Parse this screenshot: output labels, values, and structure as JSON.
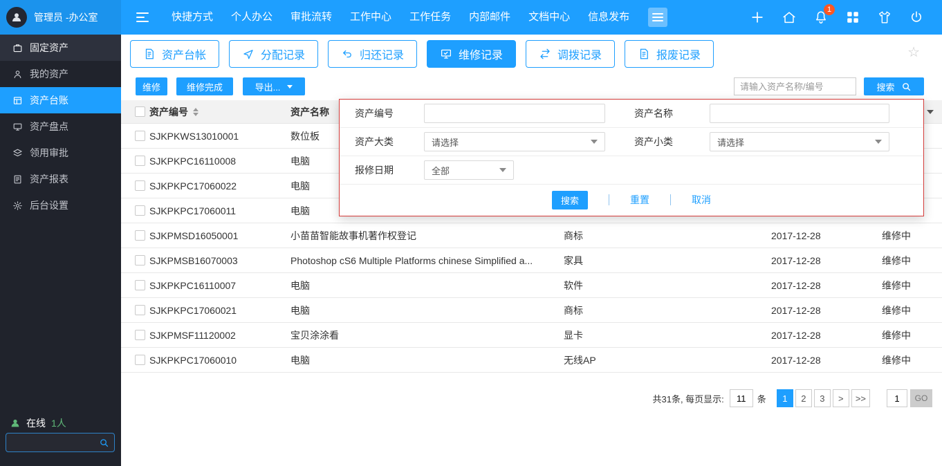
{
  "colors": {
    "accent": "#1e9fff",
    "sidebar_bg": "#20232c",
    "panel_border": "#d43c3a",
    "badge_red": "#ff5722",
    "online_green": "#5fb878"
  },
  "topbar": {
    "user_name": "管理员 -办公室",
    "nav_items": [
      "快捷方式",
      "个人办公",
      "审批流转",
      "工作中心",
      "工作任务",
      "内部邮件",
      "文档中心",
      "信息发布"
    ],
    "notification_count": "1"
  },
  "sidebar": {
    "items": [
      {
        "label": "固定资产"
      },
      {
        "label": "我的资产"
      },
      {
        "label": "资产台账"
      },
      {
        "label": "资产盘点"
      },
      {
        "label": "领用审批"
      },
      {
        "label": "资产报表"
      },
      {
        "label": "后台设置"
      }
    ],
    "online_label": "在线",
    "online_count": "1人"
  },
  "tabs": {
    "items": [
      {
        "label": "资产台帐"
      },
      {
        "label": "分配记录"
      },
      {
        "label": "归还记录"
      },
      {
        "label": "维修记录"
      },
      {
        "label": "调拨记录"
      },
      {
        "label": "报废记录"
      }
    ],
    "active_index": 3
  },
  "toolbar": {
    "repair_btn": "维修",
    "repair_done_btn": "维修完成",
    "export_btn": "导出...",
    "search_placeholder": "请输入资产名称/编号",
    "search_btn": "搜索"
  },
  "table": {
    "headers": {
      "code": "资产编号",
      "name": "资产名称"
    },
    "rows": [
      {
        "code": "SJKPKWS13010001",
        "name": "数位板",
        "category": "",
        "date": "",
        "status": ""
      },
      {
        "code": "SJKPKPC16110008",
        "name": "电脑",
        "category": "",
        "date": "",
        "status": ""
      },
      {
        "code": "SJKPKPC17060022",
        "name": "电脑",
        "category": "",
        "date": "",
        "status": ""
      },
      {
        "code": "SJKPKPC17060011",
        "name": "电脑",
        "category": "",
        "date": "",
        "status": ""
      },
      {
        "code": "SJKPMSD16050001",
        "name": "小苗苗智能故事机著作权登记",
        "category": "商标",
        "date": "2017-12-28",
        "status": "维修中"
      },
      {
        "code": "SJKPMSB16070003",
        "name": "Photoshop cS6 Multiple Platforms chinese Simplified a...",
        "category": "家具",
        "date": "2017-12-28",
        "status": "维修中"
      },
      {
        "code": "SJKPKPC16110007",
        "name": "电脑",
        "category": "软件",
        "date": "2017-12-28",
        "status": "维修中"
      },
      {
        "code": "SJKPKPC17060021",
        "name": "电脑",
        "category": "商标",
        "date": "2017-12-28",
        "status": "维修中"
      },
      {
        "code": "SJKPMSF11120002",
        "name": "宝贝涂涂看",
        "category": "显卡",
        "date": "2017-12-28",
        "status": "维修中"
      },
      {
        "code": "SJKPKPC17060010",
        "name": "电脑",
        "category": "无线AP",
        "date": "2017-12-28",
        "status": "维修中"
      }
    ]
  },
  "search_panel": {
    "code_label": "资产编号",
    "name_label": "资产名称",
    "major_label": "资产大类",
    "minor_label": "资产小类",
    "date_label": "报修日期",
    "major_value": "请选择",
    "minor_value": "请选择",
    "date_value": "全部",
    "search_btn": "搜索",
    "reset_btn": "重置",
    "cancel_btn": "取消"
  },
  "pagination": {
    "summary": "共31条, 每页显示:",
    "page_size": "11",
    "unit": "条",
    "pages": [
      "1",
      "2",
      "3"
    ],
    "next": ">",
    "last": ">>",
    "jump_value": "1",
    "go_label": "GO"
  }
}
